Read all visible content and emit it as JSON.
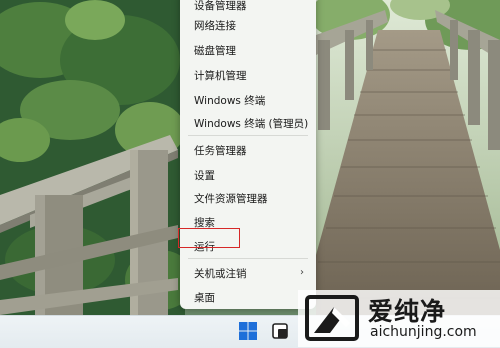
{
  "context_menu": {
    "items": [
      {
        "label": "设备管理器",
        "has_submenu": false
      },
      {
        "label": "网络连接",
        "has_submenu": false
      },
      {
        "label": "磁盘管理",
        "has_submenu": false
      },
      {
        "label": "计算机管理",
        "has_submenu": false
      },
      {
        "label": "Windows 终端",
        "has_submenu": false
      },
      {
        "label": "Windows 终端 (管理员)",
        "has_submenu": false
      },
      {
        "label": "任务管理器",
        "has_submenu": false
      },
      {
        "label": "设置",
        "has_submenu": false
      },
      {
        "label": "文件资源管理器",
        "has_submenu": false
      },
      {
        "label": "搜索",
        "has_submenu": false
      },
      {
        "label": "运行",
        "has_submenu": false
      },
      {
        "label": "关机或注销",
        "has_submenu": true
      },
      {
        "label": "桌面",
        "has_submenu": false
      }
    ],
    "highlighted_item": "运行",
    "highlight_color": "#d62828",
    "submenu_chevron": "›"
  },
  "taskbar": {
    "start_icon": "windows-start-icon",
    "taskview_icon": "task-view-icon",
    "accent": "#1e6fd9"
  },
  "watermark": {
    "brand_cn": "爱纯净",
    "url": "aichunjing.com",
    "logo_icon": "aichunjing-logo-icon"
  }
}
